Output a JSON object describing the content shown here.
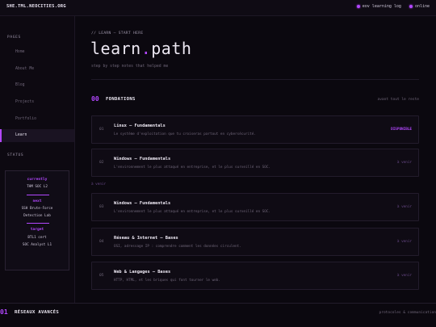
{
  "topbar": {
    "brand": "SHE.TML.NEOCITIES.ORG",
    "status": [
      {
        "label": "eov learning log"
      },
      {
        "label": "online"
      }
    ]
  },
  "sidebar": {
    "pages_title": "PAGES",
    "items": [
      {
        "label": "Home",
        "active": false
      },
      {
        "label": "About Me",
        "active": false
      },
      {
        "label": "Blog",
        "active": false
      },
      {
        "label": "Projects",
        "active": false
      },
      {
        "label": "Portfolio",
        "active": false
      },
      {
        "label": "Learn",
        "active": true
      }
    ],
    "status_title": "STATUS",
    "status_box": {
      "currently_label": "currently",
      "currently_value": "THM SOC L2",
      "next_label": "next",
      "next_value_1": "SSH Brute-Force",
      "next_value_2": "Detection Lab",
      "target_label": "target",
      "target_value_1": "BTL1 cert",
      "target_value_2": "SOC Analyst L1"
    }
  },
  "main": {
    "breadcrumb": "// LEARN — START HERE",
    "title_main": "learn",
    "title_dot": ".",
    "title_end": "path",
    "subtitle": "step by step notes that helped me",
    "section": {
      "number": "00",
      "name": "FONDATIONS",
      "hint": "avant tout le reste"
    },
    "cards": [
      {
        "index": "01",
        "title": "Linux — Fundamentals",
        "desc": "Le système d'exploitation que tu croiseras partout en cybersécurité.",
        "badge": "DISPONIBLE",
        "live": true
      },
      {
        "index": "02",
        "title": "Windows — Fundamentals",
        "desc": "L'environnement le plus attaqué en entreprise, et le plus surveillé en SOC.",
        "badge": "à venir",
        "live": false
      },
      {
        "index": "03",
        "title": "Windows — Fundamentals",
        "desc": "L'environnement le plus attaqué en entreprise, et le plus surveillé en SOC.",
        "badge": "à venir",
        "live": false
      },
      {
        "index": "04",
        "title": "Réseau & Internet — Bases",
        "desc": "OSI, adressage IP : comprendre comment les données circulent.",
        "badge": "à venir",
        "live": false
      },
      {
        "index": "05",
        "title": "Web & Langages — Bases",
        "desc": "HTTP, HTML, et les briques qui font tourner le web.",
        "badge": "à venir",
        "live": false
      }
    ],
    "float_note": "à venir"
  },
  "bottom": {
    "number": "01",
    "name": "RÉSEAUX AVANCÉS",
    "hint": "protocoles & communication"
  },
  "colors": {
    "accent": "#b347ff",
    "background": "#0b080f"
  }
}
